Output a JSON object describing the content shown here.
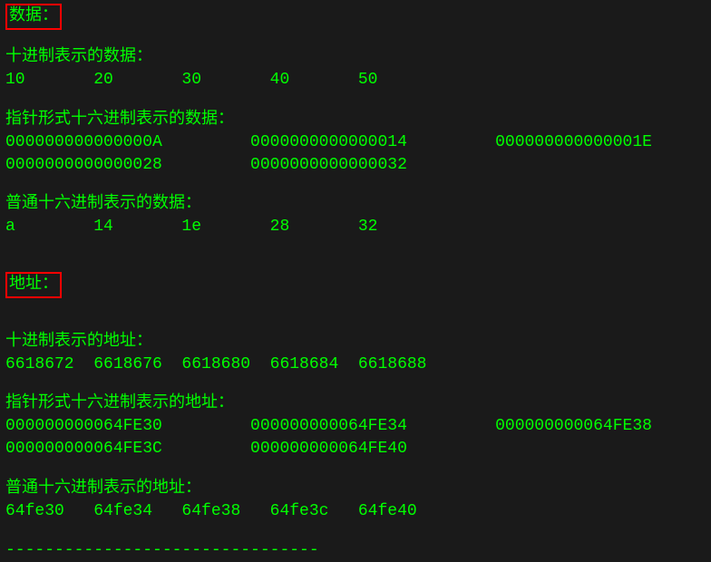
{
  "section1": {
    "header": "数据：",
    "decimal": {
      "label": "十进制表示的数据：",
      "row": "10       20       30       40       50"
    },
    "pointer_hex": {
      "label": "指针形式十六进制表示的数据：",
      "row1": "000000000000000A         0000000000000014         000000000000001E",
      "row2": "0000000000000028         0000000000000032"
    },
    "normal_hex": {
      "label": "普通十六进制表示的数据：",
      "row": "a        14       1e       28       32"
    }
  },
  "section2": {
    "header": "地址：",
    "decimal": {
      "label": "十进制表示的地址：",
      "row": "6618672  6618676  6618680  6618684  6618688"
    },
    "pointer_hex": {
      "label": "指针形式十六进制表示的地址：",
      "row1": "000000000064FE30         000000000064FE34         000000000064FE38",
      "row2": "000000000064FE3C         000000000064FE40"
    },
    "normal_hex": {
      "label": "普通十六进制表示的地址：",
      "row": "64fe30   64fe34   64fe38   64fe3c   64fe40"
    }
  },
  "divider": "--------------------------------"
}
